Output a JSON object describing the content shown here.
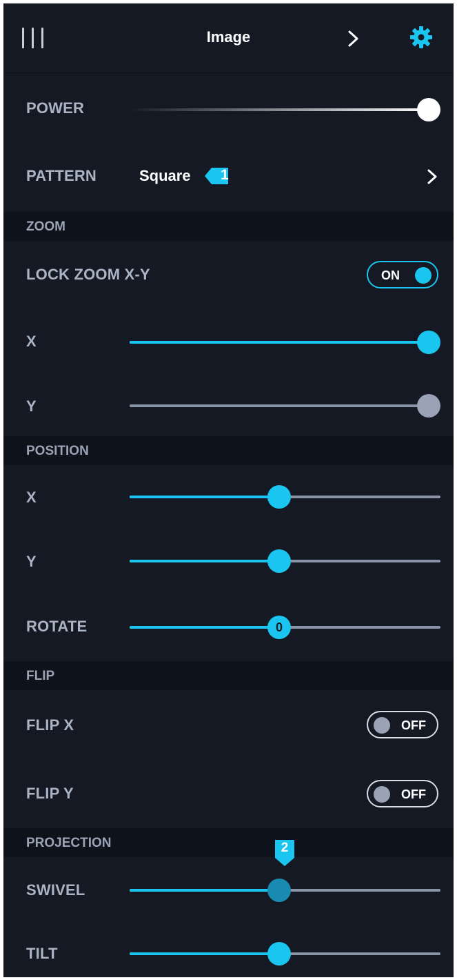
{
  "header": {
    "menu_icon": "menu-bars-icon",
    "title": "Image",
    "next_icon": "chevron-right-icon",
    "settings_icon": "gear-icon"
  },
  "colors": {
    "background": "#141924",
    "section_background": "#0e121b",
    "accent": "#1ac6ef",
    "track_inactive": "#8a93a6",
    "label": "#aab4c4"
  },
  "power": {
    "label": "POWER",
    "value_fraction": 1.0
  },
  "pattern": {
    "label": "PATTERN",
    "value": "Square",
    "badge": "1"
  },
  "zoom": {
    "section": "ZOOM",
    "lock": {
      "label": "LOCK ZOOM X-Y",
      "state": "ON",
      "on": true
    },
    "x": {
      "label": "X",
      "value_fraction": 1.0
    },
    "y": {
      "label": "Y",
      "value_fraction": 1.0,
      "disabled": true
    }
  },
  "position": {
    "section": "POSITION",
    "x": {
      "label": "X",
      "value_fraction": 0.5
    },
    "y": {
      "label": "Y",
      "value_fraction": 0.5
    },
    "rotate": {
      "label": "ROTATE",
      "value_fraction": 0.5,
      "thumb_text": "0"
    }
  },
  "flip": {
    "section": "FLIP",
    "x": {
      "label": "FLIP X",
      "state": "OFF",
      "on": false
    },
    "y": {
      "label": "FLIP Y",
      "state": "OFF",
      "on": false
    }
  },
  "projection": {
    "section": "PROJECTION",
    "swivel": {
      "label": "SWIVEL",
      "value_fraction": 0.5,
      "marker": "2"
    },
    "tilt": {
      "label": "TILT",
      "value_fraction": 0.5
    }
  }
}
